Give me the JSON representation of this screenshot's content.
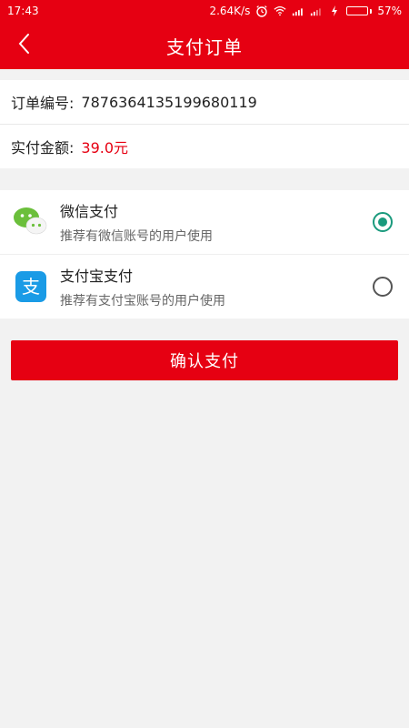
{
  "status": {
    "time": "17:43",
    "speed": "2.64K/s",
    "battery_pct": "57%",
    "battery_level": 0.57
  },
  "nav": {
    "title": "支付订单"
  },
  "order": {
    "no_label": "订单编号:",
    "no_value": "7876364135199680119",
    "amount_label": "实付金额:",
    "amount_value": "39.0元"
  },
  "payment": {
    "options": [
      {
        "name": "微信支付",
        "desc": "推荐有微信账号的用户使用",
        "icon": "wechat-icon",
        "selected": true
      },
      {
        "name": "支付宝支付",
        "desc": "推荐有支付宝账号的用户使用",
        "icon": "alipay-icon",
        "selected": false
      }
    ]
  },
  "confirm_label": "确认支付",
  "colors": {
    "brand": "#e60012",
    "radio_checked": "#1a9a7d"
  }
}
